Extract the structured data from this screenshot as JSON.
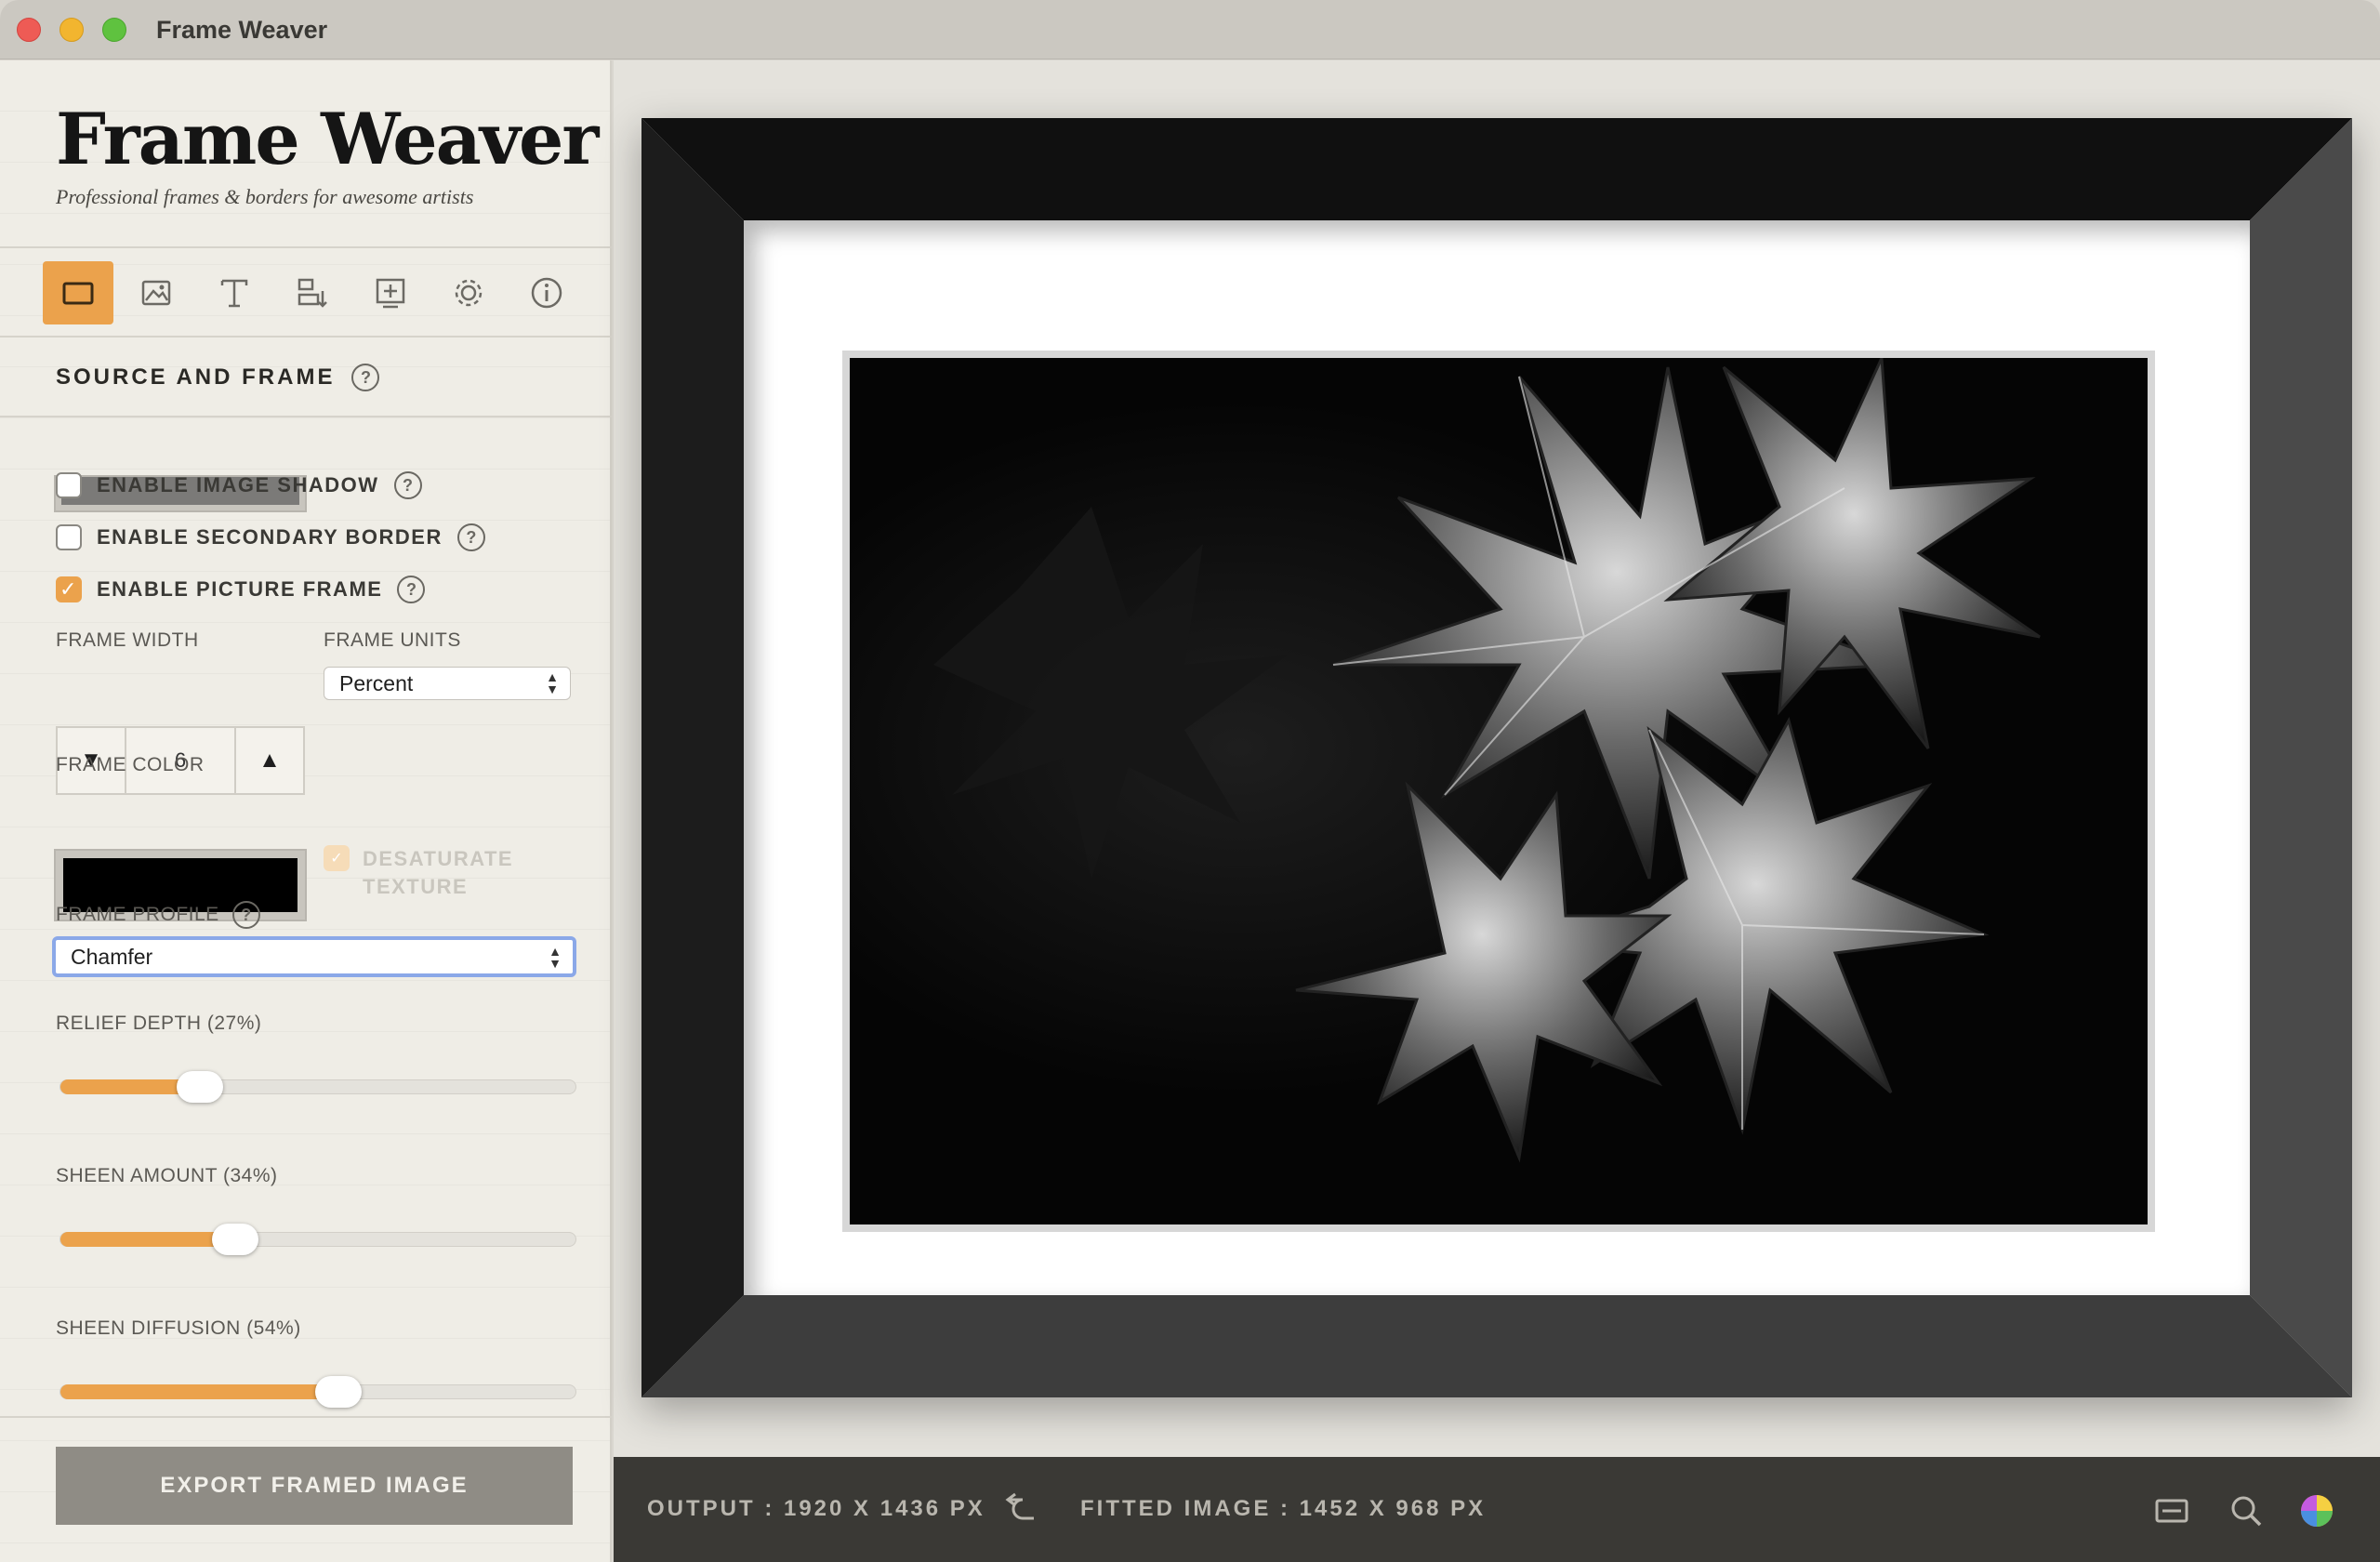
{
  "window": {
    "title": "Frame Weaver"
  },
  "sidebar": {
    "brand": "Frame Weaver",
    "tagline": "Professional frames & borders for awesome artists",
    "toolbar": [
      {
        "icon": "frame-icon",
        "active": true
      },
      {
        "icon": "image-icon",
        "active": false
      },
      {
        "icon": "text-icon",
        "active": false
      },
      {
        "icon": "layout-icon",
        "active": false
      },
      {
        "icon": "add-layer-icon",
        "active": false
      },
      {
        "icon": "gear-icon",
        "active": false
      },
      {
        "icon": "info-icon",
        "active": false
      }
    ],
    "section_title": "SOURCE AND FRAME",
    "help_glyph": "?",
    "checkboxes": {
      "image_shadow": {
        "label": "ENABLE IMAGE SHADOW",
        "checked": false
      },
      "secondary_border": {
        "label": "ENABLE SECONDARY BORDER",
        "checked": false
      },
      "picture_frame": {
        "label": "ENABLE PICTURE FRAME",
        "checked": true
      }
    },
    "frame_width": {
      "label": "FRAME WIDTH",
      "value": "6",
      "down": "▼",
      "up": "▲"
    },
    "frame_units": {
      "label": "FRAME UNITS",
      "value": "Percent"
    },
    "frame_color": {
      "label": "FRAME COLOR",
      "color": "#000000"
    },
    "desaturate": {
      "line1": "DESATURATE",
      "line2": "TEXTURE",
      "checked": true,
      "disabled": true
    },
    "frame_profile": {
      "label": "FRAME PROFILE",
      "value": "Chamfer"
    },
    "relief_depth": {
      "label": "RELIEF DEPTH (27%)",
      "value": 27
    },
    "sheen_amount": {
      "label": "SHEEN AMOUNT (34%)",
      "value": 34
    },
    "sheen_diffusion": {
      "label": "SHEEN DIFFUSION (54%)",
      "value": 54
    },
    "export_label": "EXPORT FRAMED IMAGE"
  },
  "status": {
    "output": "OUTPUT : 1920 X 1436 PX",
    "fitted": "FITTED IMAGE : 1452 X 968 PX"
  },
  "colors": {
    "accent": "#eba24c",
    "frame": "#000000",
    "status_bg": "#3a3935"
  }
}
